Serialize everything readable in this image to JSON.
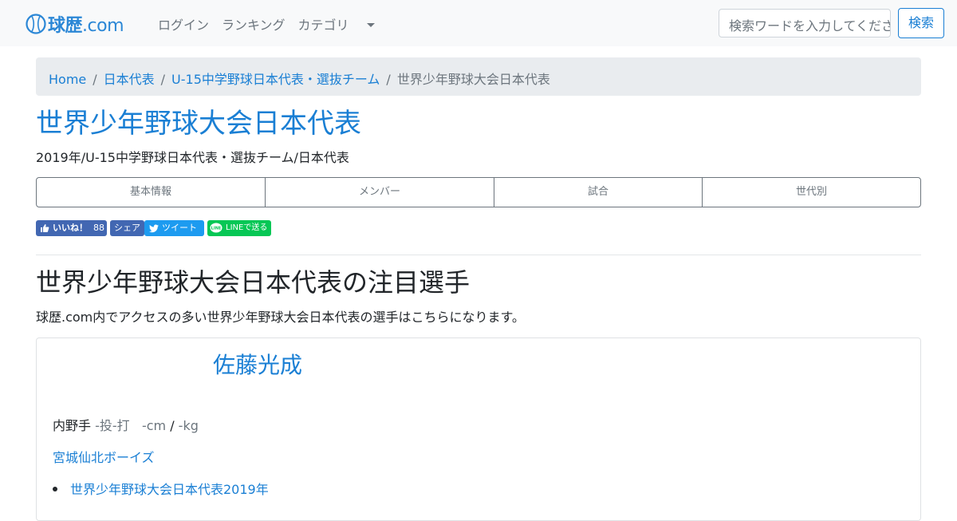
{
  "header": {
    "logo_text": "球歴",
    "logo_domain": ".com",
    "nav": {
      "login": "ログイン",
      "ranking": "ランキング",
      "category": "カテゴリ"
    },
    "search": {
      "placeholder": "検索ワードを入力してください",
      "button": "検索"
    }
  },
  "breadcrumb": {
    "items": [
      "Home",
      "日本代表",
      "U-15中学野球日本代表・選抜チーム"
    ],
    "separator": "/",
    "current": "世界少年野球大会日本代表"
  },
  "page": {
    "title": "世界少年野球大会日本代表",
    "subtitle": "2019年/U-15中学野球日本代表・選抜チーム/日本代表"
  },
  "tabs": [
    "基本情報",
    "メンバー",
    "試合",
    "世代別"
  ],
  "social": {
    "like_label": "いいね！",
    "like_count": "88",
    "share_label": "シェア",
    "tweet_label": "ツイート",
    "line_label": "LINEで送る"
  },
  "section": {
    "title": "世界少年野球大会日本代表の注目選手",
    "description": "球歴.com内でアクセスの多い世界少年野球大会日本代表の選手はこちらになります。"
  },
  "player": {
    "name": "佐藤光成",
    "position": "内野手",
    "throw_bat": "-投-打",
    "height": "-cm",
    "slash": "/",
    "weight": "-kg",
    "team": "宮城仙北ボーイズ",
    "teams_list": [
      "世界少年野球大会日本代表2019年"
    ]
  },
  "colors": {
    "link": "#1a7fd4",
    "navbar_bg": "#f8f9fa",
    "breadcrumb_bg": "#e9ecef",
    "facebook": "#4267b2",
    "twitter": "#1d9bf0",
    "line": "#06c755"
  }
}
